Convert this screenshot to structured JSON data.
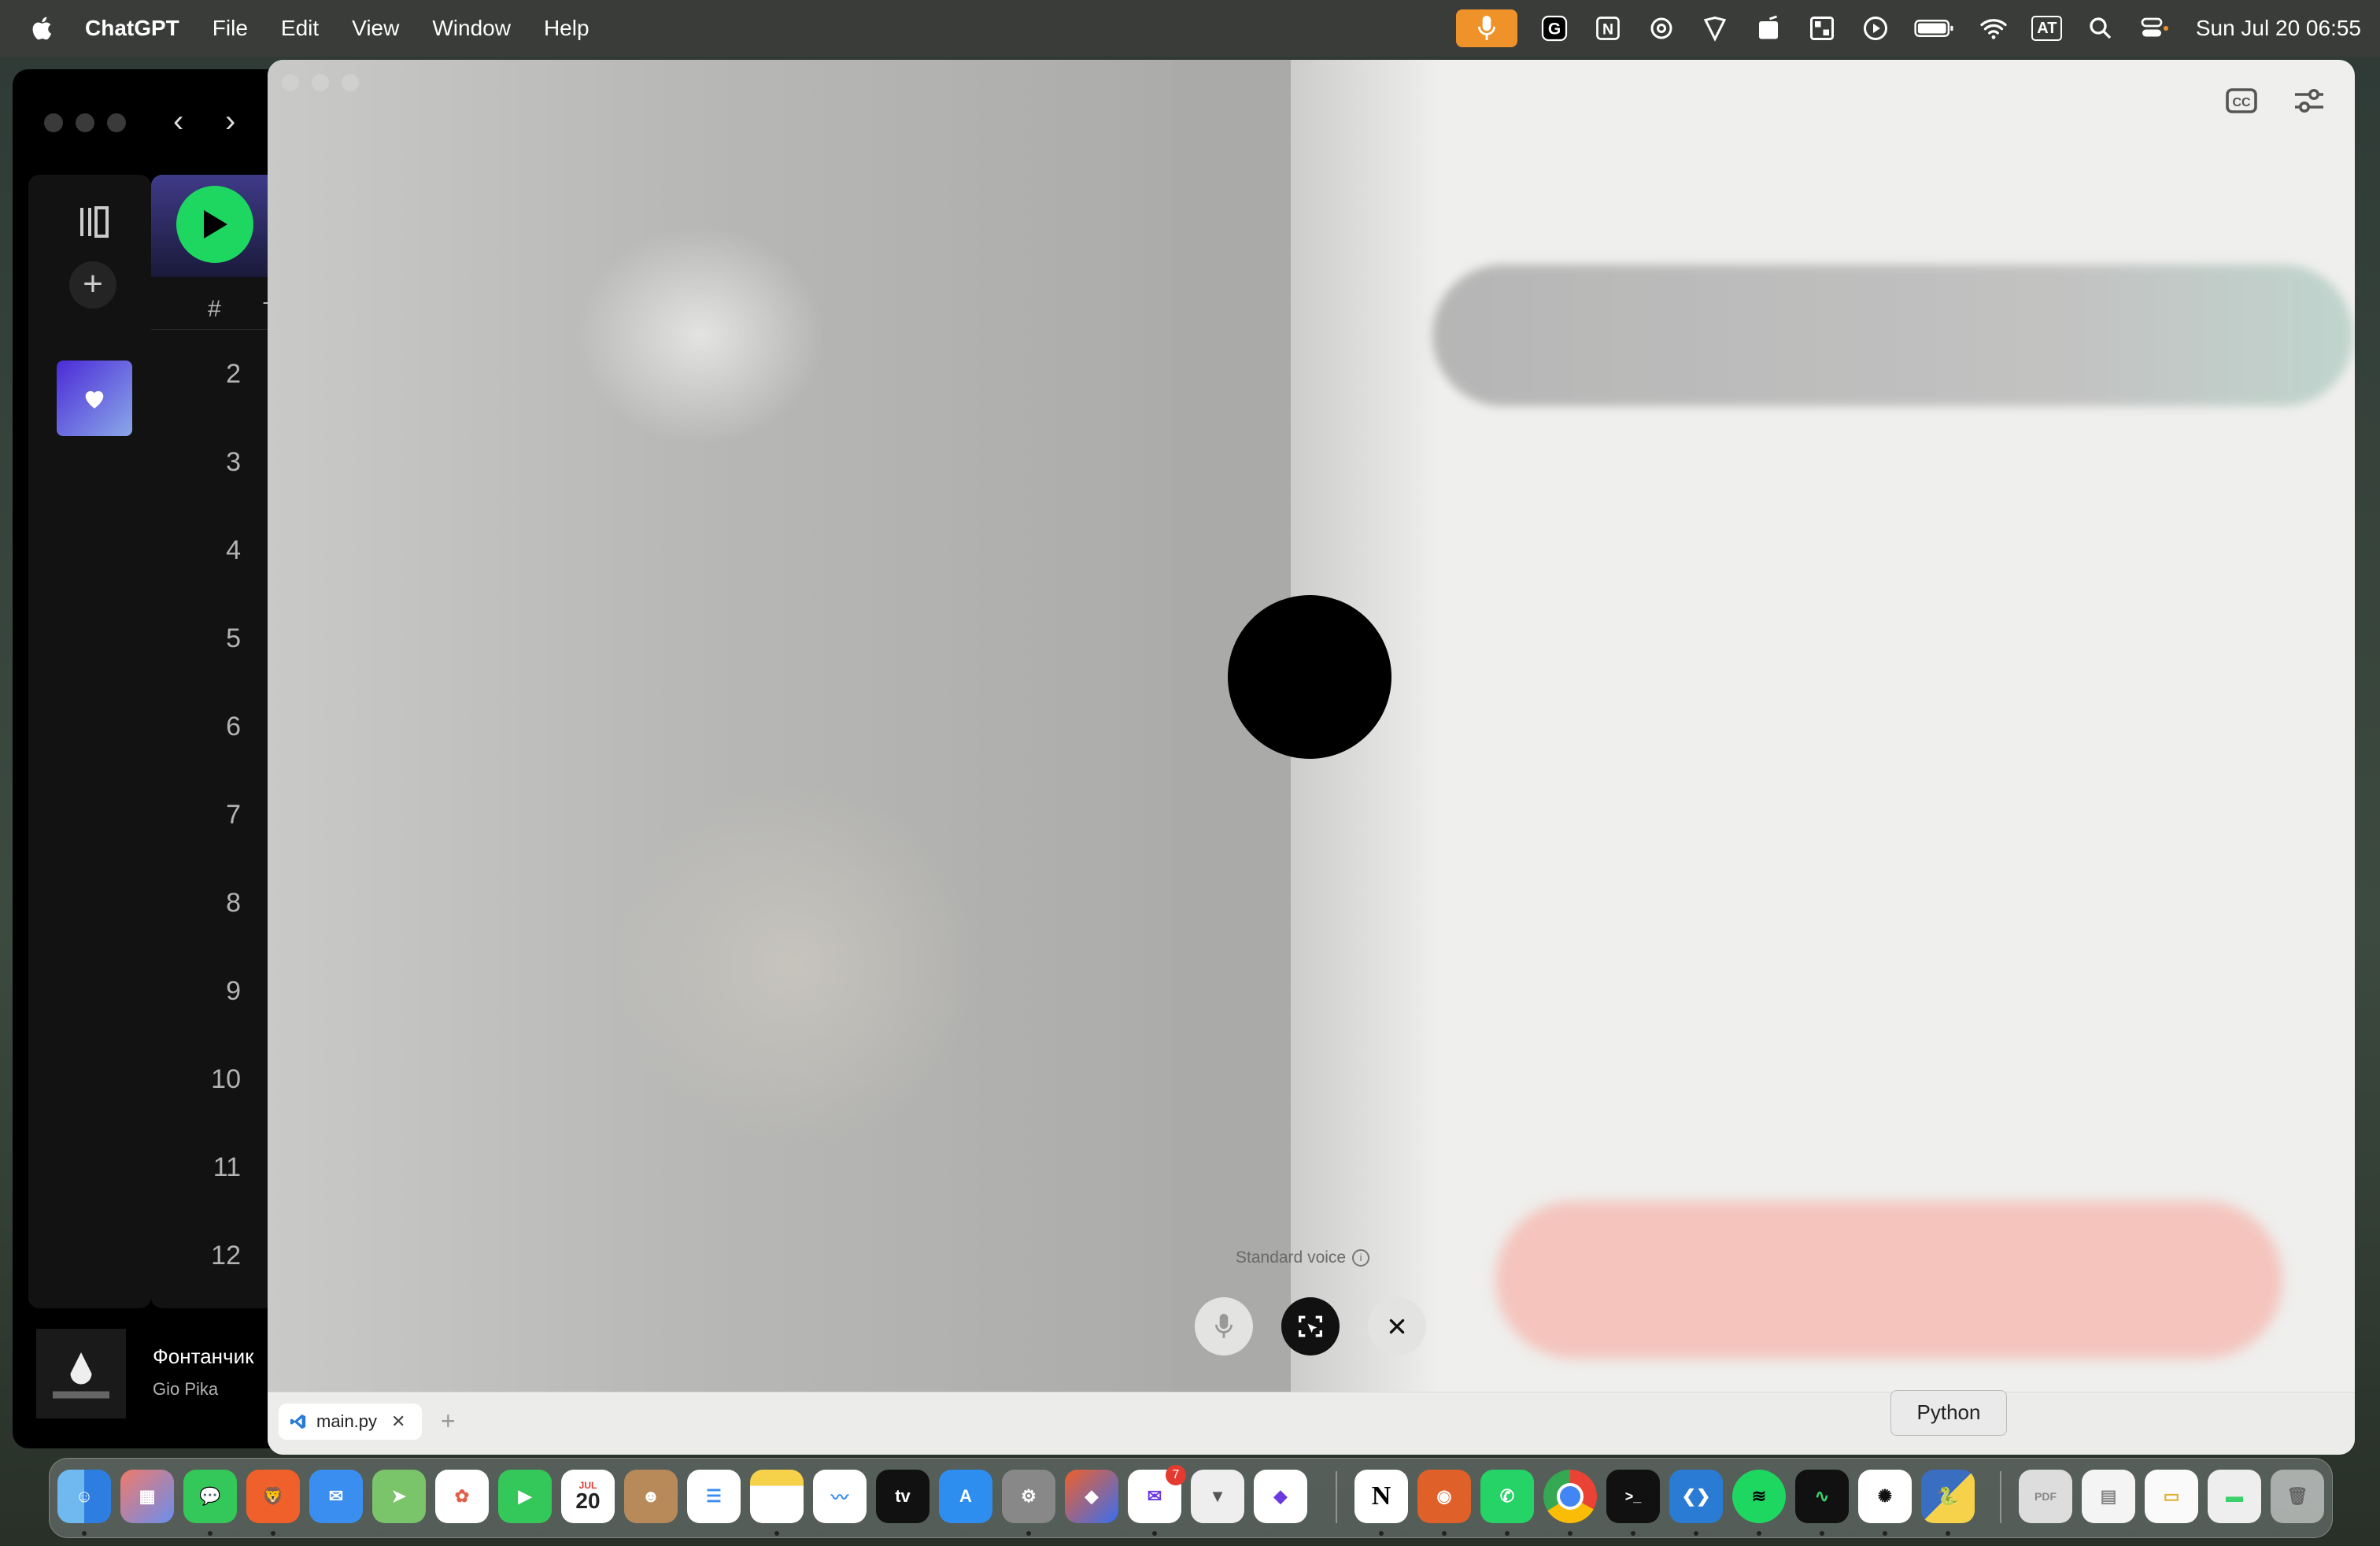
{
  "menubar": {
    "app_name": "ChatGPT",
    "menus": [
      "File",
      "Edit",
      "View",
      "Window",
      "Help"
    ],
    "clock": "Sun Jul 20  06:55",
    "keyboard_indicator": "AT"
  },
  "spotify": {
    "track_header_hash": "#",
    "track_header_title_initial": "T",
    "track_numbers": [
      "2",
      "3",
      "4",
      "5",
      "6",
      "7",
      "8",
      "9",
      "10",
      "11",
      "12"
    ],
    "now_playing": {
      "title": "Фонтанчик",
      "artist": "Gio Pika"
    }
  },
  "voice": {
    "mode_label": "Standard voice"
  },
  "editor_tab": {
    "filename": "main.py"
  },
  "dock": {
    "tooltip": "Python",
    "calendar_month": "JUL",
    "calendar_day": "20",
    "mail_badge": "7",
    "apps": [
      "Finder",
      "Launchpad",
      "Messages",
      "Brave",
      "Mail",
      "Maps",
      "Photos",
      "FaceTime",
      "Calendar",
      "Contacts",
      "Reminders",
      "Notes",
      "Freeform",
      "Apple TV",
      "App Store",
      "System Settings",
      "Shortcuts",
      "Spark",
      "Vectorize",
      "Things",
      "Notion",
      "DuckDuckGo",
      "WhatsApp",
      "Chrome",
      "Terminal",
      "VS Code",
      "Spotify",
      "Activity Monitor",
      "ChatGPT",
      "Python"
    ]
  }
}
